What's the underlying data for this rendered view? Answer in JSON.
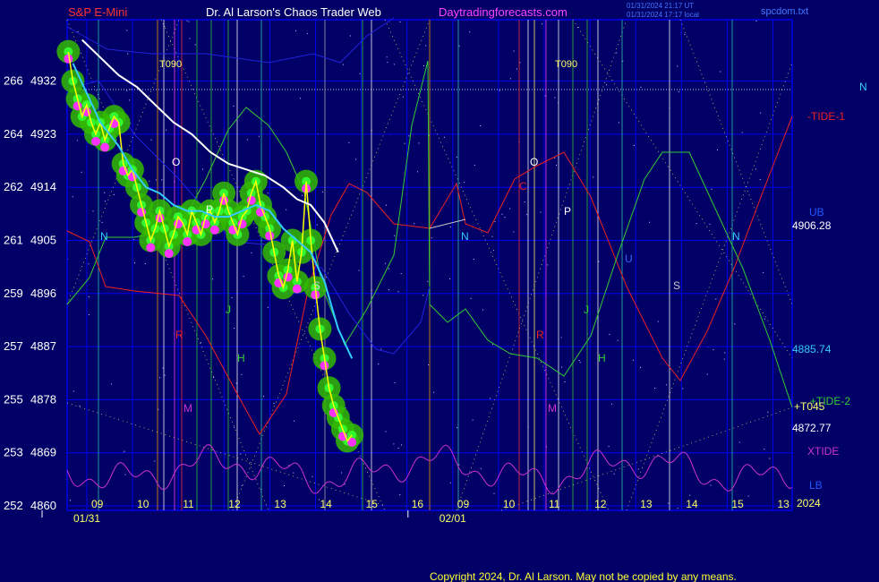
{
  "header": {
    "symbol": "S&P E-Mini",
    "title": "Dr. Al Larson's Chaos Trader Web",
    "site": "Daytradingforecasts.com",
    "timestamp_ut": "01/31/2024 21:17 UT",
    "timestamp_local": "01/31/2024 17:17 local",
    "file": "spcdom.txt"
  },
  "footer": {
    "copyright": "Copyright 2024, Dr. Al Larson. May not be copied by any means."
  },
  "colors": {
    "background": "#000066",
    "grid": "#0000ee",
    "price_trace": "#ffff00",
    "glow": "#33bb00",
    "dots": "#ff33ff",
    "ma_fast": "#33ccff",
    "ma_slow": "#ffffff",
    "tide1": "#ee2222",
    "tide2": "#33cc33",
    "xtide": "#cc33cc",
    "band": "#2222dd"
  },
  "chart_data": {
    "type": "line",
    "title": "S&P E-Mini",
    "y_ticks": [
      {
        "left": "266",
        "price": "4932",
        "value": 4932
      },
      {
        "left": "264",
        "price": "4923",
        "value": 4923
      },
      {
        "left": "262",
        "price": "4914",
        "value": 4914
      },
      {
        "left": "261",
        "price": "4905",
        "value": 4905
      },
      {
        "left": "259",
        "price": "4896",
        "value": 4896
      },
      {
        "left": "257",
        "price": "4887",
        "value": 4887
      },
      {
        "left": "255",
        "price": "4878",
        "value": 4878
      },
      {
        "left": "253",
        "price": "4869",
        "value": 4869
      },
      {
        "left": "252",
        "price": "4860",
        "value": 4860
      }
    ],
    "ylim": [
      4860,
      4939
    ],
    "x_range": [
      8.9,
      21.2
    ],
    "x_ticks": [
      {
        "label": "09",
        "x": 9.5
      },
      {
        "label": "10",
        "x": 10.5
      },
      {
        "label": "11",
        "x": 11.5
      },
      {
        "label": "12",
        "x": 12.5
      },
      {
        "label": "13",
        "x": 13.5
      },
      {
        "label": "14",
        "x": 14.5
      },
      {
        "label": "15",
        "x": 15.5
      },
      {
        "label": "16",
        "x": 16.5
      },
      {
        "label": "09",
        "x": 17.5
      },
      {
        "label": "10",
        "x": 18.5
      },
      {
        "label": "11",
        "x": 19.5
      },
      {
        "label": "12",
        "x": 20.5
      },
      {
        "label": "13",
        "x": 21.5
      },
      {
        "label": "14",
        "x": 22.5
      },
      {
        "label": "15",
        "x": 23.5
      },
      {
        "label": "13",
        "x": 24.5
      }
    ],
    "dates": [
      {
        "label": "01/31",
        "x": 9.5
      },
      {
        "label": "02/01",
        "x": 17.5
      }
    ],
    "year_label": "2024",
    "series": [
      {
        "name": "S&P E-Mini",
        "color": "#ffff00",
        "points": [
          [
            8.9,
            4937
          ],
          [
            9.0,
            4932
          ],
          [
            9.1,
            4929
          ],
          [
            9.2,
            4926
          ],
          [
            9.3,
            4928
          ],
          [
            9.4,
            4925
          ],
          [
            9.5,
            4923
          ],
          [
            9.6,
            4925
          ],
          [
            9.7,
            4922
          ],
          [
            9.8,
            4924
          ],
          [
            9.9,
            4926
          ],
          [
            10.0,
            4925
          ],
          [
            10.1,
            4918
          ],
          [
            10.2,
            4916
          ],
          [
            10.3,
            4917
          ],
          [
            10.4,
            4914
          ],
          [
            10.5,
            4911
          ],
          [
            10.6,
            4908
          ],
          [
            10.7,
            4905
          ],
          [
            10.8,
            4907
          ],
          [
            10.9,
            4910
          ],
          [
            11.0,
            4907
          ],
          [
            11.1,
            4904
          ],
          [
            11.2,
            4906
          ],
          [
            11.3,
            4909
          ],
          [
            11.4,
            4908
          ],
          [
            11.5,
            4906
          ],
          [
            11.6,
            4910
          ],
          [
            11.7,
            4908
          ],
          [
            11.8,
            4906
          ],
          [
            11.9,
            4909
          ],
          [
            12.0,
            4910
          ],
          [
            12.1,
            4908
          ],
          [
            12.2,
            4910
          ],
          [
            12.3,
            4913
          ],
          [
            12.4,
            4910
          ],
          [
            12.5,
            4908
          ],
          [
            12.6,
            4906
          ],
          [
            12.7,
            4909
          ],
          [
            12.8,
            4910
          ],
          [
            12.9,
            4913
          ],
          [
            13.0,
            4915
          ],
          [
            13.1,
            4911
          ],
          [
            13.2,
            4909
          ],
          [
            13.3,
            4907
          ],
          [
            13.4,
            4903
          ],
          [
            13.5,
            4899
          ],
          [
            13.6,
            4897
          ],
          [
            13.7,
            4900
          ],
          [
            13.8,
            4905
          ],
          [
            13.9,
            4898
          ],
          [
            14.0,
            4903
          ],
          [
            14.1,
            4915
          ],
          [
            14.2,
            4905
          ],
          [
            14.3,
            4897
          ],
          [
            14.4,
            4890
          ],
          [
            14.5,
            4885
          ],
          [
            14.6,
            4880
          ],
          [
            14.7,
            4877
          ],
          [
            14.8,
            4875
          ],
          [
            14.9,
            4873
          ],
          [
            15.0,
            4871
          ],
          [
            15.1,
            4872
          ]
        ]
      },
      {
        "name": "MA fast",
        "color": "#33ccff",
        "points": [
          [
            9.0,
            4935
          ],
          [
            9.3,
            4930
          ],
          [
            9.6,
            4925
          ],
          [
            10.0,
            4921
          ],
          [
            10.3,
            4917
          ],
          [
            10.6,
            4914
          ],
          [
            10.9,
            4913
          ],
          [
            11.2,
            4911
          ],
          [
            11.5,
            4910
          ],
          [
            11.8,
            4910
          ],
          [
            12.1,
            4909
          ],
          [
            12.4,
            4909
          ],
          [
            12.7,
            4910
          ],
          [
            13.0,
            4911
          ],
          [
            13.3,
            4910
          ],
          [
            13.6,
            4907
          ],
          [
            13.9,
            4905
          ],
          [
            14.2,
            4903
          ],
          [
            14.5,
            4898
          ],
          [
            14.8,
            4890
          ],
          [
            15.1,
            4885
          ]
        ]
      },
      {
        "name": "MA slow",
        "color": "#ffffff",
        "points": [
          [
            9.2,
            4939
          ],
          [
            9.6,
            4936
          ],
          [
            10.0,
            4933
          ],
          [
            10.4,
            4931
          ],
          [
            10.8,
            4928
          ],
          [
            11.2,
            4925
          ],
          [
            11.6,
            4923
          ],
          [
            12.0,
            4920
          ],
          [
            12.4,
            4918
          ],
          [
            12.8,
            4917
          ],
          [
            13.2,
            4916
          ],
          [
            13.6,
            4914
          ],
          [
            13.9,
            4912
          ],
          [
            14.2,
            4911
          ],
          [
            14.5,
            4908
          ],
          [
            14.8,
            4903
          ]
        ]
      }
    ],
    "labels": [
      {
        "text": "-TIDE-1",
        "color": "#ee2222"
      },
      {
        "text": "+TIDE-2",
        "color": "#33cc33"
      },
      {
        "text": "XTIDE",
        "color": "#cc33cc"
      },
      {
        "text": "+T045",
        "color": "#ffff66"
      },
      {
        "text": "UB",
        "color": "#2255ff"
      },
      {
        "text": "LB",
        "color": "#2255ff"
      },
      {
        "text": "N",
        "color": "#33ccff"
      }
    ],
    "values": [
      {
        "text": "4906.28",
        "color": "#ffffff"
      },
      {
        "text": "4885.74",
        "color": "#33ccff"
      },
      {
        "text": "4872.77",
        "color": "#ffffff"
      }
    ],
    "markers": [
      {
        "text": "T090",
        "color": "#ffff66"
      },
      {
        "text": "T090",
        "color": "#ffff66"
      },
      {
        "text": "O",
        "color": "#ffffff"
      },
      {
        "text": "O",
        "color": "#ffffff"
      },
      {
        "text": "P",
        "color": "#ffffff"
      },
      {
        "text": "P",
        "color": "#ffffff"
      },
      {
        "text": "N",
        "color": "#33ccff"
      },
      {
        "text": "N",
        "color": "#33ccff"
      },
      {
        "text": "N",
        "color": "#33ccff"
      },
      {
        "text": "S",
        "color": "#cccccc"
      },
      {
        "text": "S",
        "color": "#cccccc"
      },
      {
        "text": "J",
        "color": "#33cc33"
      },
      {
        "text": "J",
        "color": "#33cc33"
      },
      {
        "text": "H",
        "color": "#33cc33"
      },
      {
        "text": "H",
        "color": "#33cc33"
      },
      {
        "text": "R",
        "color": "#ee2222"
      },
      {
        "text": "R",
        "color": "#ee2222"
      },
      {
        "text": "M",
        "color": "#cc33cc"
      },
      {
        "text": "M",
        "color": "#cc33cc"
      },
      {
        "text": "C",
        "color": "#ee2222"
      },
      {
        "text": "U",
        "color": "#3366ff"
      }
    ]
  }
}
